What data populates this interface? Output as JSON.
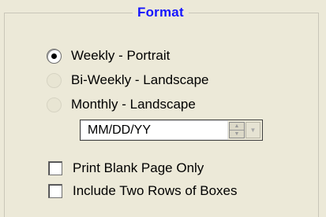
{
  "group": {
    "title": "Format"
  },
  "radios": [
    {
      "label": "Weekly - Portrait",
      "checked": true,
      "enabled": true
    },
    {
      "label": "Bi-Weekly - Landscape",
      "checked": false,
      "enabled": false
    },
    {
      "label": "Monthly - Landscape",
      "checked": false,
      "enabled": false
    }
  ],
  "date_format": {
    "value": "MM/DD/YY",
    "enabled": false
  },
  "checkboxes": [
    {
      "label": "Print Blank Page Only",
      "checked": false
    },
    {
      "label": "Include Two Rows of Boxes",
      "checked": false
    }
  ]
}
